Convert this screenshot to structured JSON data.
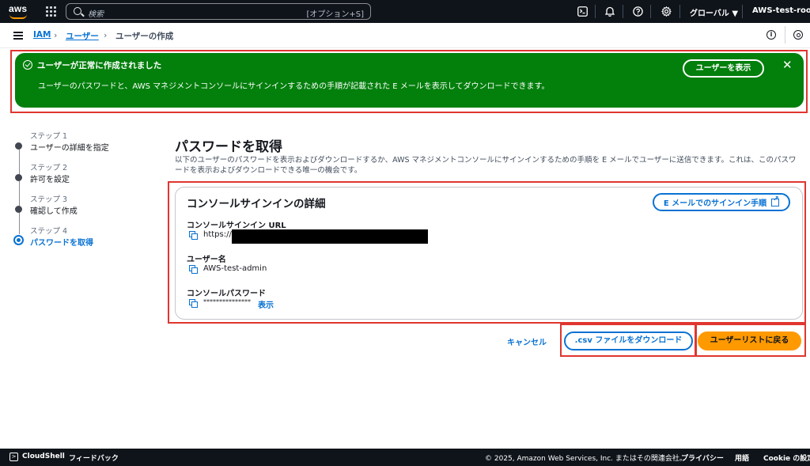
{
  "topnav": {
    "logo": "aws",
    "search_placeholder": "検索",
    "search_shortcut": "[オプション+S]",
    "region": "グローバル ▼",
    "account": "AWS-test-root ▼",
    "icons": [
      "cloudshell-icon",
      "bell-icon",
      "help-icon",
      "gear-icon"
    ]
  },
  "breadcrumb": {
    "items": [
      "IAM",
      "ユーザー",
      "ユーザーの作成"
    ]
  },
  "flash": {
    "title": "ユーザーが正常に作成されました",
    "message": "ユーザーのパスワードと、AWS マネジメントコンソールにサインインするための手順が記載された E メールを表示してダウンロードできます。",
    "view_button": "ユーザーを表示",
    "close": "✕"
  },
  "steps": [
    {
      "num": "ステップ 1",
      "label": "ユーザーの詳細を指定"
    },
    {
      "num": "ステップ 2",
      "label": "許可を設定"
    },
    {
      "num": "ステップ 3",
      "label": "確認して作成"
    },
    {
      "num": "ステップ 4",
      "label": "パスワードを取得"
    }
  ],
  "main": {
    "title": "パスワードを取得",
    "description": "以下のユーザーのパスワードを表示およびダウンロードするか、AWS マネジメントコンソールにサインインするための手順を E メールでユーザーに送信できます。これは、このパスワードを表示およびダウンロードできる唯一の機会です。",
    "card": {
      "title": "コンソールサインインの詳細",
      "email_button": "E メールでのサインイン手順",
      "url_label": "コンソールサインイン URL",
      "url_value": "https://",
      "username_label": "ユーザー名",
      "username_value": "AWS-test-admin",
      "password_label": "コンソールパスワード",
      "password_value": "***************",
      "show_link": "表示"
    },
    "actions": {
      "cancel": "キャンセル",
      "download_csv": ".csv ファイルをダウンロード",
      "return": "ユーザーリストに戻る"
    }
  },
  "footer": {
    "cloudshell": "CloudShell",
    "feedback": "フィードバック",
    "copyright": "© 2025, Amazon Web Services, Inc. またはその関連会社。",
    "privacy": "プライバシー",
    "terms": "用語",
    "cookie": "Cookie の設定"
  }
}
